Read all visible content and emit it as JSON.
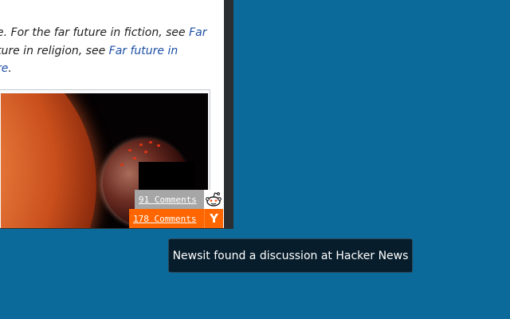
{
  "article": {
    "hatnote_lines": [
      {
        "before": "e. For the far future in fiction, see ",
        "link": "Far"
      },
      {
        "before": "ture in religion, see ",
        "link": "Far future in"
      },
      {
        "before": "",
        "link": "re",
        "after": "."
      }
    ]
  },
  "newsit": {
    "reddit": {
      "comments_label": "91 Comments",
      "icon": "reddit-alien-icon"
    },
    "hacker_news": {
      "comments_label": "178 Comments",
      "icon": "y-combinator-icon",
      "icon_glyph": "Y"
    },
    "notification": "Newsit found a discussion at Hacker News"
  },
  "colors": {
    "desktop": "#0c6a9a",
    "link": "#1d4fa5",
    "hn_orange": "#ff6600",
    "reddit_badge": "#a6a6a6",
    "toast_bg": "#071d2b"
  }
}
